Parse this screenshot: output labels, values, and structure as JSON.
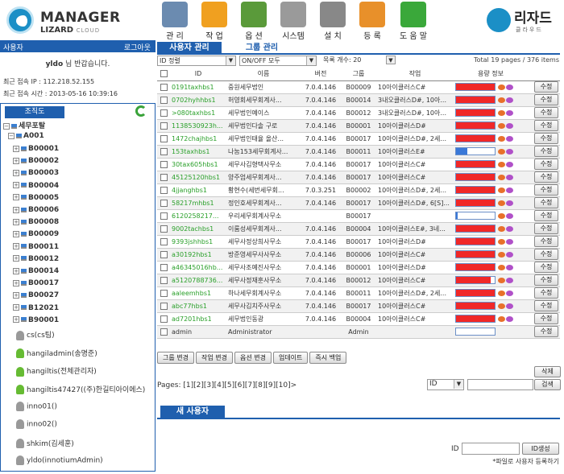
{
  "header": {
    "logo_title": "MANAGER",
    "logo_sub1": "LIZARD",
    "logo_sub2": "CLOUD",
    "brand": "리자드",
    "brand_sub": "클라우드",
    "toolbar": [
      {
        "label": "관 리",
        "icon": "admin-users-icon",
        "color": "#6b8bb0"
      },
      {
        "label": "작 업",
        "icon": "task-search-icon",
        "color": "#f0a020"
      },
      {
        "label": "옵 션",
        "icon": "checklist-icon",
        "color": "#5a9a3a"
      },
      {
        "label": "시스템",
        "icon": "gear-icon",
        "color": "#9a9a9a"
      },
      {
        "label": "설 치",
        "icon": "cdrom-icon",
        "color": "#888888"
      },
      {
        "label": "등 록",
        "icon": "key-icon",
        "color": "#e8902a"
      },
      {
        "label": "도 움 말",
        "icon": "help-icon",
        "color": "#3aa83a"
      }
    ]
  },
  "sidebar": {
    "user_label": "사용자",
    "logout": "로그아웃",
    "welcome_name": "yldo",
    "welcome_suffix": "님 반갑습니다.",
    "last_ip": "최근 접속 IP : 112.218.52.155",
    "last_time": "최근 접속 시간 : 2013-05-16 10:39:16",
    "tree_tab": "조직도",
    "root": "세무포탈",
    "group": "A001",
    "nodes": [
      "B00001",
      "B00002",
      "B00003",
      "B00004",
      "B00005",
      "B00006",
      "B00008",
      "B00009",
      "B00011",
      "B00012",
      "B00014",
      "B00017",
      "B00027",
      "B12021",
      "B90001"
    ],
    "users": [
      {
        "name": "cs(cs팀)",
        "color": "gray"
      },
      {
        "name": "hangiladmin(송명준)",
        "color": "green"
      },
      {
        "name": "hangiltis(전체관리자)",
        "color": "green"
      },
      {
        "name": "hangiltis47427((주)한길티아이에스)",
        "color": "green"
      },
      {
        "name": "inno01()",
        "color": "gray"
      },
      {
        "name": "inno02()",
        "color": "gray"
      },
      {
        "name": "shkim(김세훈)",
        "color": "gray"
      },
      {
        "name": "yldo(innotiumAdmin)",
        "color": "gray"
      }
    ]
  },
  "tabs": [
    "사용자 관리",
    "그룹 관리"
  ],
  "filters": {
    "sort": "ID 정렬",
    "onoff": "ON/OFF 모두",
    "count_label": "목록 개수: 20",
    "total": "Total 19 pages / 376 items"
  },
  "table": {
    "headers": [
      "",
      "ID",
      "이름",
      "버전",
      "그룹",
      "작업",
      "용량 정보",
      ""
    ],
    "edit_label": "수정",
    "rows": [
      {
        "id": "0191taxhbs1",
        "name": "중원세무법인",
        "ver": "7.0.4.146",
        "group": "B00009",
        "task": "10아이클러스C#",
        "usage": 1.0,
        "ie": true
      },
      {
        "id": "0702hyhhbs1",
        "name": "허영회세무회계사...",
        "ver": "7.0.4.146",
        "group": "B00014",
        "task": "3내오클러스D#, 10아...",
        "usage": 1.0,
        "ie": true
      },
      {
        "id": ">080taxhbs1",
        "name": "세무법인예이스",
        "ver": "7.0.4.146",
        "group": "B00012",
        "task": "3내오클러스D#, 10아...",
        "usage": 1.0,
        "ie": true
      },
      {
        "id": "1138530923h...",
        "name": "세무법인다솔 구로",
        "ver": "7.0.4.146",
        "group": "B00001",
        "task": "10아이클러스D#",
        "usage": 1.0,
        "ie": true
      },
      {
        "id": "1472chajhbs1",
        "name": "세무법인태율 올산...",
        "ver": "7.0.4.146",
        "group": "B00017",
        "task": "10아이클러스D#, 2세...",
        "usage": 1.0,
        "ie": true
      },
      {
        "id": "153taxhbs1",
        "name": "나눔153세무회계사...",
        "ver": "7.0.4.146",
        "group": "B00011",
        "task": "10아이클러스E#",
        "usage": 0.3,
        "ie": true
      },
      {
        "id": "30tax605hbs1",
        "name": "세무사김형택사무소",
        "ver": "7.0.4.146",
        "group": "B00017",
        "task": "10아이클러스C#",
        "usage": 1.0,
        "ie": true
      },
      {
        "id": "45125120hbs1",
        "name": "양주엄세무회계사...",
        "ver": "7.0.4.146",
        "group": "B00017",
        "task": "10아이클러스C#",
        "usage": 1.0,
        "ie": true
      },
      {
        "id": "4jjanghbs1",
        "name": "황현수(세번세무회...",
        "ver": "7.0.3.251",
        "group": "B00002",
        "task": "10아이클러스D#, 2세...",
        "usage": 1.0,
        "ie": true
      },
      {
        "id": "58217mhbs1",
        "name": "정인호세무회계사...",
        "ver": "7.0.4.146",
        "group": "B00017",
        "task": "10아이클러스D#, 6[S]...",
        "usage": 1.0,
        "ie": true
      },
      {
        "id": "6120258217...",
        "name": "우리세무회계사무소",
        "ver": "",
        "group": "B00017",
        "task": "",
        "usage": 0.05,
        "ie": true
      },
      {
        "id": "9002tachbs1",
        "name": "이룸성세무회계사...",
        "ver": "7.0.4.146",
        "group": "B00004",
        "task": "10아이클러스E#, 3네...",
        "usage": 1.0,
        "ie": true
      },
      {
        "id": "9393jshhbs1",
        "name": "세무사정상희사무소",
        "ver": "7.0.4.146",
        "group": "B00017",
        "task": "10아이클러스D#",
        "usage": 1.0,
        "ie": true
      },
      {
        "id": "a30192hbs1",
        "name": "방준영세무사사무소",
        "ver": "7.0.4.146",
        "group": "B00006",
        "task": "10아이클러스C#",
        "usage": 1.0,
        "ie": true
      },
      {
        "id": "a46345016hb...",
        "name": "세무사조예진사무소",
        "ver": "7.0.4.146",
        "group": "B00001",
        "task": "10아이클러스D#",
        "usage": 1.0,
        "ie": true
      },
      {
        "id": "a5120788736...",
        "name": "세무사정재훈사무소",
        "ver": "7.0.4.146",
        "group": "B00012",
        "task": "10아이클러스C#",
        "usage": 0.9,
        "ie": true
      },
      {
        "id": "aaleemhbs1",
        "name": "하나세무회계사무소",
        "ver": "7.0.4.146",
        "group": "B00011",
        "task": "10아이클러스D#, 2세...",
        "usage": 1.0,
        "ie": true
      },
      {
        "id": "abc77hbs1",
        "name": "세무사김치주사무소",
        "ver": "7.0.4.146",
        "group": "B00017",
        "task": "10아이클러스C#",
        "usage": 1.0,
        "ie": true
      },
      {
        "id": "ad7201hbs1",
        "name": "세무법인동광",
        "ver": "7.0.4.146",
        "group": "B00004",
        "task": "10아이클러스C#",
        "usage": 1.0,
        "ie": true
      },
      {
        "id": "admin",
        "name": "Administrator",
        "ver": "",
        "group": "Admin",
        "task": "",
        "usage": 0.0,
        "ie": false
      }
    ]
  },
  "actions": [
    "그룹 변경",
    "작업 변경",
    "옵션 변경",
    "업데이트",
    "즉시 백업"
  ],
  "delete_label": "삭제",
  "pages_text": "Pages: [1][2][3][4][5][6][7][8][9][10]>",
  "search": {
    "field": "ID",
    "button": "검색"
  },
  "new_user_tab": "새 사용자",
  "id_label": "ID",
  "id_gen": "ID생성",
  "note": "*파일로 사용자 등록하기",
  "colors": {
    "accent": "#1f5fae",
    "bar_red": "#f02828",
    "bar_blue": "#3a78d8",
    "id_green": "#2aa02a"
  }
}
